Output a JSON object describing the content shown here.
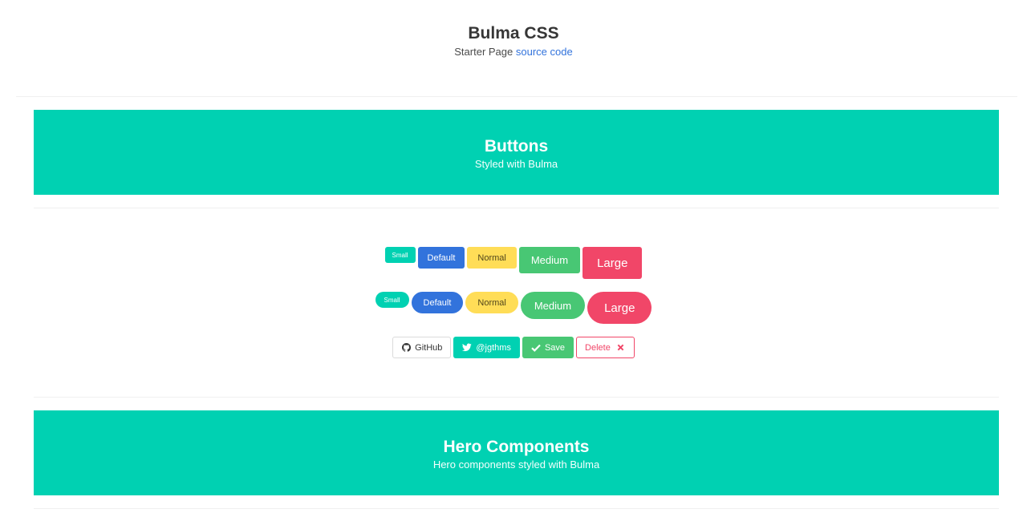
{
  "header": {
    "title": "Bulma CSS",
    "subtitle_prefix": "Starter Page",
    "source_link": "source code"
  },
  "hero_buttons": {
    "title": "Buttons",
    "subtitle": "Styled with Bulma"
  },
  "buttons_row1": {
    "small": "Small",
    "default": "Default",
    "normal": "Normal",
    "medium": "Medium",
    "large": "Large"
  },
  "buttons_row2": {
    "small": "Small",
    "default": "Default",
    "normal": "Normal",
    "medium": "Medium",
    "large": "Large"
  },
  "icon_buttons": {
    "github": "GitHub",
    "twitter": "@jgthms",
    "save": "Save",
    "delete": "Delete"
  },
  "hero_components": {
    "title": "Hero Components",
    "subtitle": "Hero components styled with Bulma"
  },
  "colors": {
    "primary": "#00d1b2",
    "info": "#3273dc",
    "warning": "#ffdd57",
    "success": "#48c774",
    "danger": "#f14668",
    "link": "#3273dc"
  },
  "icons": [
    "github-icon",
    "twitter-icon",
    "check-icon",
    "close-icon"
  ]
}
